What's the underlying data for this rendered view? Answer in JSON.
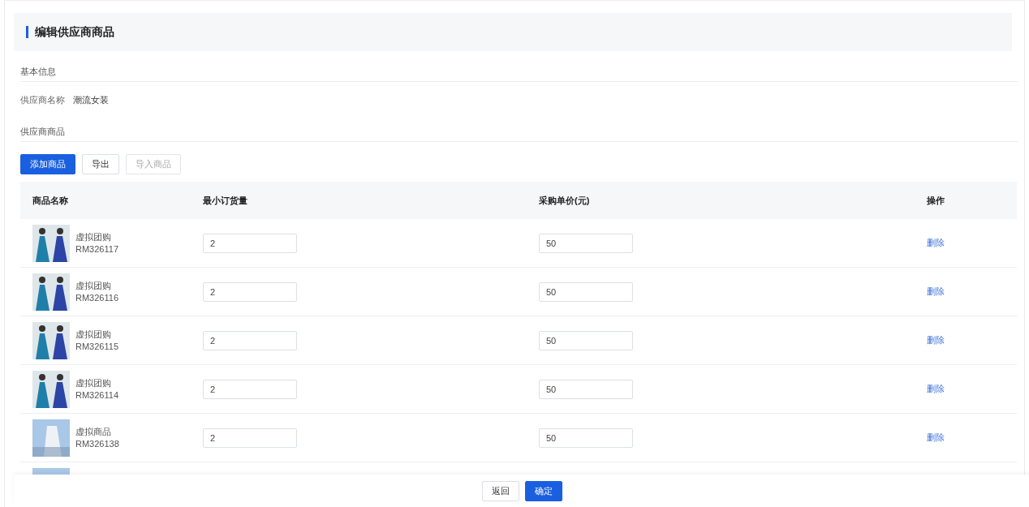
{
  "page": {
    "title": "编辑供应商商品"
  },
  "basic_section": {
    "title": "基本信息",
    "fields": [
      {
        "label": "供应商名称",
        "value": "潮流女装"
      }
    ]
  },
  "goods_section": {
    "title": "供应商商品"
  },
  "toolbar": [
    {
      "label": "添加商品",
      "kind": "primary",
      "disabled": false
    },
    {
      "label": "导出",
      "kind": "default",
      "disabled": false
    },
    {
      "label": "导入商品",
      "kind": "default",
      "disabled": true
    }
  ],
  "table": {
    "columns": [
      "商品名称",
      "最小订货量",
      "采购单价(元)",
      "操作"
    ],
    "rows": [
      {
        "kind": "dress-pair",
        "name": "虚拟团购",
        "code": "RM326117",
        "min_qty": "2",
        "price": "50",
        "action": "删除"
      },
      {
        "kind": "dress-pair",
        "name": "虚拟团购",
        "code": "RM326116",
        "min_qty": "2",
        "price": "50",
        "action": "删除"
      },
      {
        "kind": "dress-pair",
        "name": "虚拟团购",
        "code": "RM326115",
        "min_qty": "2",
        "price": "50",
        "action": "删除"
      },
      {
        "kind": "dress-pair",
        "name": "虚拟团购",
        "code": "RM326114",
        "min_qty": "2",
        "price": "50",
        "action": "删除"
      },
      {
        "kind": "white-dress",
        "name": "虚拟商品",
        "code": "RM326138",
        "min_qty": "2",
        "price": "50",
        "action": "删除"
      },
      {
        "kind": "white-dress"
      }
    ]
  },
  "footer": {
    "buttons": [
      {
        "label": "返回",
        "kind": "default"
      },
      {
        "label": "确定",
        "kind": "primary"
      }
    ]
  }
}
